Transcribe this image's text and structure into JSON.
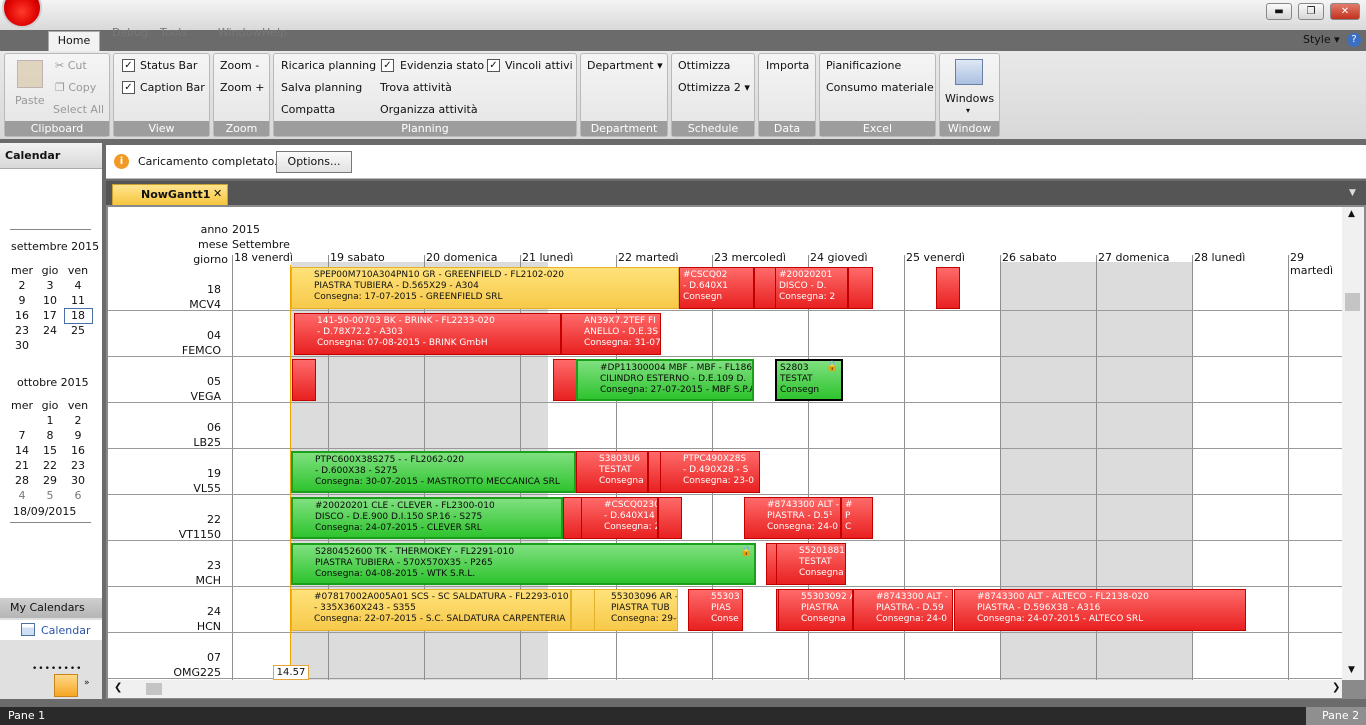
{
  "titlebar": {
    "menus": [
      "Debug",
      "Tools",
      "Window",
      "Help"
    ]
  },
  "ribbon": {
    "tab": "Home",
    "style_label": "Style",
    "help_label": "?",
    "clipboard": {
      "paste": "Paste",
      "cut": "Cut",
      "copy": "Copy",
      "select_all": "Select All",
      "group": "Clipboard"
    },
    "view": {
      "status_bar": "Status Bar",
      "caption_bar": "Caption Bar",
      "group": "View"
    },
    "zoom": {
      "zoom_out": "Zoom -",
      "zoom_in": "Zoom +",
      "group": "Zoom"
    },
    "planning": {
      "reload": "Ricarica planning",
      "save": "Salva planning",
      "compact": "Compatta",
      "highlight": "Evidenzia stato",
      "find": "Trova attività",
      "organize": "Organizza attività",
      "constraints": "Vincoli attivi",
      "group": "Planning"
    },
    "department": {
      "dropdown": "Department",
      "group": "Department"
    },
    "schedule": {
      "opt1": "Ottimizza",
      "opt2": "Ottimizza 2",
      "group": "Schedule"
    },
    "data": {
      "import": "Importa",
      "group": "Data"
    },
    "excel": {
      "plan": "Pianificazione",
      "material": "Consumo materiale",
      "group": "Excel"
    },
    "window": {
      "windows": "Windows",
      "group": "Window"
    }
  },
  "sidebar": {
    "title": "Calendar",
    "month1": {
      "title": "settembre 2015",
      "headers": [
        "mer",
        "gio",
        "ven"
      ],
      "rows": [
        [
          "2",
          "3",
          "4"
        ],
        [
          "9",
          "10",
          "11"
        ],
        [
          "16",
          "17",
          "18"
        ],
        [
          "23",
          "24",
          "25"
        ],
        [
          "30",
          "",
          ""
        ]
      ]
    },
    "month2": {
      "title": "ottobre 2015",
      "headers": [
        "mer",
        "gio",
        "ven"
      ],
      "rows": [
        [
          "",
          "1",
          "2"
        ],
        [
          "7",
          "8",
          "9"
        ],
        [
          "14",
          "15",
          "16"
        ],
        [
          "21",
          "22",
          "23"
        ],
        [
          "28",
          "29",
          "30"
        ],
        [
          "4",
          "5",
          "6"
        ]
      ]
    },
    "selected_date": "18/09/2015",
    "my_calendars": "My Calendars",
    "calendar_item": "Calendar"
  },
  "infobar": {
    "message": "Caricamento completato.",
    "options": "Options..."
  },
  "doc_tab": {
    "label": "NowGantt1"
  },
  "gantt": {
    "header": {
      "anno_label": "anno",
      "anno": "2015",
      "mese_label": "mese",
      "mese": "Settembre",
      "giorno_label": "giorno"
    },
    "days": [
      "18 venerdì",
      "19 sabato",
      "20 domenica",
      "21 lunedì",
      "22 martedì",
      "23 mercoledì",
      "24 giovedì",
      "25 venerdì",
      "26 sabato",
      "27 domenica",
      "28 lunedì",
      "29 martedì"
    ],
    "resources": [
      {
        "num": "18",
        "name": "MCV4"
      },
      {
        "num": "04",
        "name": "FEMCO"
      },
      {
        "num": "05",
        "name": "VEGA"
      },
      {
        "num": "06",
        "name": "LB25"
      },
      {
        "num": "19",
        "name": "VL55"
      },
      {
        "num": "22",
        "name": "VT1150"
      },
      {
        "num": "23",
        "name": "MCH"
      },
      {
        "num": "24",
        "name": "HCN"
      },
      {
        "num": "07",
        "name": "OMG225"
      }
    ],
    "current_time": "14.57",
    "tasks": [
      {
        "l1": "SPEP00M710A304PN10 GR - GREENFIELD - FL2102-020",
        "l2": "PIASTRA TUBIERA - D.565X29 - A304",
        "l3": "Consegna: 17-07-2015 - GREENFIELD SRL"
      },
      {
        "l1": "#CSCQ02",
        "l2": "- D.640X1",
        "l3": "Consegn"
      },
      {
        "l1": "#20020201",
        "l2": "DISCO - D.",
        "l3": "Consegna: 2"
      },
      {
        "l1": "141-50-00703 BK - BRINK - FL2233-020",
        "l2": "- D.78X72.2 - A303",
        "l3": "Consegna: 07-08-2015 - BRINK GmbH"
      },
      {
        "l1": "AN39X7.2TEF FI",
        "l2": "ANELLO - D.E.3S",
        "l3": "Consegna: 31-07"
      },
      {
        "l1": "#DP11300004 MBF - MBF - FL1863",
        "l2": "CILINDRO ESTERNO - D.E.109 D.",
        "l3": "Consegna: 27-07-2015 - MBF S.P.A."
      },
      {
        "l1": "S2803",
        "l2": "TESTAT",
        "l3": "Consegn"
      },
      {
        "l1": "PTPC600X38S275 -  - FL2062-020",
        "l2": " - D.600X38 - S275",
        "l3": "Consegna: 30-07-2015 - MASTROTTO MECCANICA SRL"
      },
      {
        "l1": "S3803U6",
        "l2": "TESTAT",
        "l3": "Consegna"
      },
      {
        "l1": "PTPC490X28S",
        "l2": " - D.490X28 - S",
        "l3": "Consegna: 23-0"
      },
      {
        "l1": "#20020201 CLE - CLEVER - FL2300-010",
        "l2": "DISCO - D.E.900 D.I.150 SP.16 - S275",
        "l3": "Consegna: 24-07-2015 - CLEVER SRL"
      },
      {
        "l1": "#CSCQ0230",
        "l2": " - D.640X14 -",
        "l3": "Consegna: 24"
      },
      {
        "l1": "#8743300 ALT -",
        "l2": "PIASTRA - D.5¹",
        "l3": "Consegna: 24-0"
      },
      {
        "l1": "#",
        "l2": "P",
        "l3": "C"
      },
      {
        "l1": "S280452600 TK - THERMOKEY - FL2291-010",
        "l2": "PIASTRA TUBIERA - 570X570X35 - P265",
        "l3": "Consegna: 04-08-2015 - WTK S.R.L."
      },
      {
        "l1": "S5201881",
        "l2": "TESTAT",
        "l3": "Consegna"
      },
      {
        "l1": "#07817002A005A01 SCS - SC SALDATURA - FL2293-010",
        "l2": " - 335X360X243 - S355",
        "l3": "Consegna: 22-07-2015 - S.C. SALDATURA CARPENTERIA"
      },
      {
        "l1": "55303096 AR -",
        "l2": "PIASTRA TUB",
        "l3": "Consegna: 29-0"
      },
      {
        "l1": "55303",
        "l2": "PIAS",
        "l3": "Conse"
      },
      {
        "l1": "55303092 A",
        "l2": "PIASTRA",
        "l3": "Consegna"
      },
      {
        "l1": "#8743300 ALT -",
        "l2": "PIASTRA - D.59",
        "l3": "Consegna: 24-0"
      },
      {
        "l1": "#8743300 ALT - ALTECO - FL2138-020",
        "l2": "PIASTRA - D.596X38 - A316",
        "l3": "Consegna: 24-07-2015 - ALTECO SRL"
      }
    ]
  },
  "status": {
    "pane1": "Pane 1",
    "pane2": "Pane 2"
  }
}
